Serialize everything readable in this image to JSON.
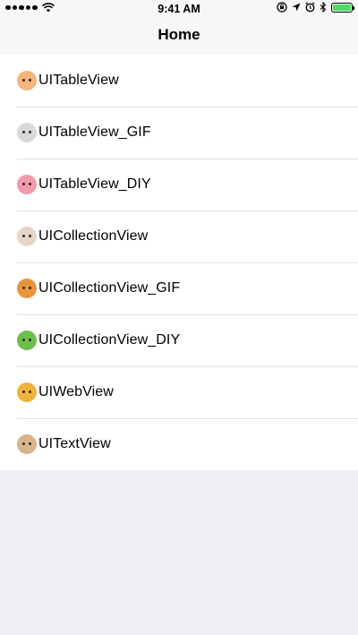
{
  "status_bar": {
    "time": "9:41 AM",
    "battery_level": 1.0,
    "icons": [
      "signal-dots-icon",
      "wifi-icon",
      "orientation-lock-icon",
      "location-icon",
      "alarm-icon",
      "bluetooth-icon",
      "battery-icon"
    ]
  },
  "nav": {
    "title": "Home"
  },
  "list": {
    "items": [
      {
        "label": "UITableView",
        "icon": "hamster-face-icon",
        "color": "#f4b57a"
      },
      {
        "label": "UITableView_GIF",
        "icon": "panda-face-icon",
        "color": "#d9d9d9"
      },
      {
        "label": "UITableView_DIY",
        "icon": "pig-face-icon",
        "color": "#f39aa8"
      },
      {
        "label": "UICollectionView",
        "icon": "cow-face-icon",
        "color": "#e6d6c8"
      },
      {
        "label": "UICollectionView_GIF",
        "icon": "lion-face-icon",
        "color": "#e8953a"
      },
      {
        "label": "UICollectionView_DIY",
        "icon": "frog-face-icon",
        "color": "#6cbf4b"
      },
      {
        "label": "UIWebView",
        "icon": "tiger-face-icon",
        "color": "#f0b43a"
      },
      {
        "label": "UITextView",
        "icon": "dog-face-icon",
        "color": "#d9b48a"
      }
    ]
  }
}
